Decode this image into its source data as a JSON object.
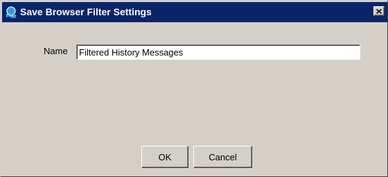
{
  "window": {
    "title": "Save Browser Filter Settings",
    "titlebar_color": "#0a246a",
    "icon": "app-icon",
    "close_icon": "close-icon"
  },
  "form": {
    "name_label": "Name",
    "name_value": "Filtered History Messages"
  },
  "buttons": {
    "ok_label": "OK",
    "cancel_label": "Cancel"
  }
}
